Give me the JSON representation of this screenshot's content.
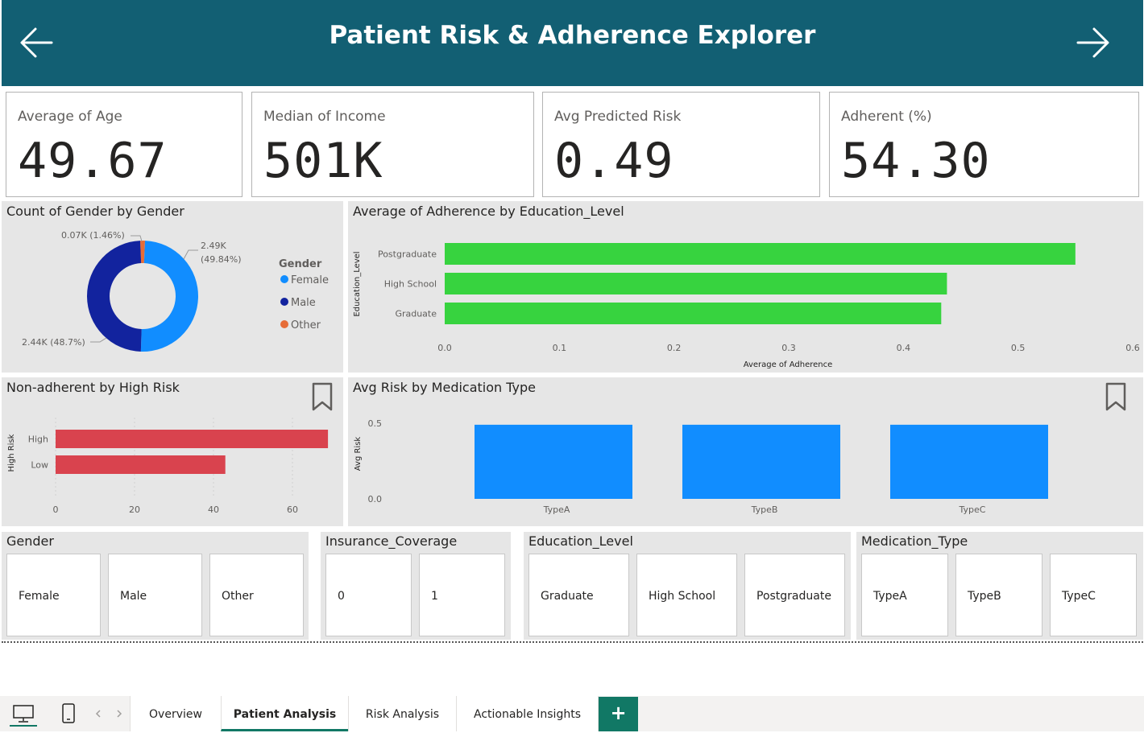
{
  "header": {
    "title": "Patient Risk & Adherence Explorer",
    "back_icon": "arrow-left-icon",
    "forward_icon": "arrow-right-icon",
    "bg_color": "#125f73"
  },
  "kpis": [
    {
      "label": "Average of Age",
      "value": "49.67"
    },
    {
      "label": "Median of Income",
      "value": "501K"
    },
    {
      "label": "Avg Predicted Risk",
      "value": "0.49"
    },
    {
      "label": "Adherent (%)",
      "value": "54.30"
    }
  ],
  "gender_chart": {
    "title": "Count of Gender by Gender",
    "legend_title": "Gender",
    "labels": {
      "female": [
        "2.49K",
        "(49.84%)"
      ],
      "male": "2.44K (48.7%)",
      "other": "0.07K (1.46%)"
    }
  },
  "education_chart": {
    "title": "Average of Adherence by Education_Level",
    "xlabel": "Average of Adherence",
    "ylabel": "Education_Level",
    "ticks": [
      "0.0",
      "0.1",
      "0.2",
      "0.3",
      "0.4",
      "0.5",
      "0.6"
    ]
  },
  "risk_chart": {
    "title": "Non-adherent by High Risk",
    "ylabel": "High Risk",
    "ticks": [
      "0",
      "20",
      "40",
      "60"
    ],
    "bookmark_icon": "bookmark-icon"
  },
  "med_chart": {
    "title": "Avg Risk by Medication Type",
    "ylabel": "Avg Risk",
    "ticks": [
      "0.0",
      "0.5"
    ],
    "bookmark_icon": "bookmark-icon"
  },
  "chart_data": [
    {
      "type": "pie",
      "variant": "donut",
      "title": "Count of Gender by Gender",
      "legend_title": "Gender",
      "legend_position": "right",
      "categories": [
        "Female",
        "Male",
        "Other"
      ],
      "values": [
        2490,
        2440,
        70
      ],
      "percent": [
        49.84,
        48.7,
        1.46
      ],
      "colors": [
        "#118dff",
        "#12239e",
        "#e66c37"
      ]
    },
    {
      "type": "bar",
      "orientation": "horizontal",
      "title": "Average of Adherence by Education_Level",
      "categories": [
        "Postgraduate",
        "High School",
        "Graduate"
      ],
      "values": [
        0.55,
        0.438,
        0.433
      ],
      "xlabel": "Average of Adherence",
      "ylabel": "Education_Level",
      "xlim": [
        0,
        0.6
      ],
      "color": "#37d33f"
    },
    {
      "type": "bar",
      "orientation": "horizontal",
      "title": "Non-adherent by High Risk",
      "categories": [
        "High",
        "Low"
      ],
      "values": [
        69,
        43
      ],
      "ylabel": "High Risk",
      "xlim": [
        0,
        70
      ],
      "color": "#d9434e"
    },
    {
      "type": "bar",
      "orientation": "vertical",
      "title": "Avg Risk by Medication Type",
      "categories": [
        "TypeA",
        "TypeB",
        "TypeC"
      ],
      "values": [
        0.49,
        0.49,
        0.49
      ],
      "ylabel": "Avg Risk",
      "ylim": [
        0,
        0.5
      ],
      "color": "#118dff"
    }
  ],
  "slicers": [
    {
      "title": "Gender",
      "options": [
        "Female",
        "Male",
        "Other"
      ]
    },
    {
      "title": "Insurance_Coverage",
      "options": [
        "0",
        "1"
      ]
    },
    {
      "title": "Education_Level",
      "options": [
        "Graduate",
        "High School",
        "Postgraduate"
      ]
    },
    {
      "title": "Medication_Type",
      "options": [
        "TypeA",
        "TypeB",
        "TypeC"
      ]
    }
  ],
  "footer": {
    "desktop_icon": "desktop-icon",
    "phone_icon": "phone-icon",
    "tabs": [
      "Overview",
      "Patient Analysis",
      "Risk Analysis",
      "Actionable Insights"
    ],
    "active_tab": "Patient Analysis",
    "add_label": "+"
  }
}
